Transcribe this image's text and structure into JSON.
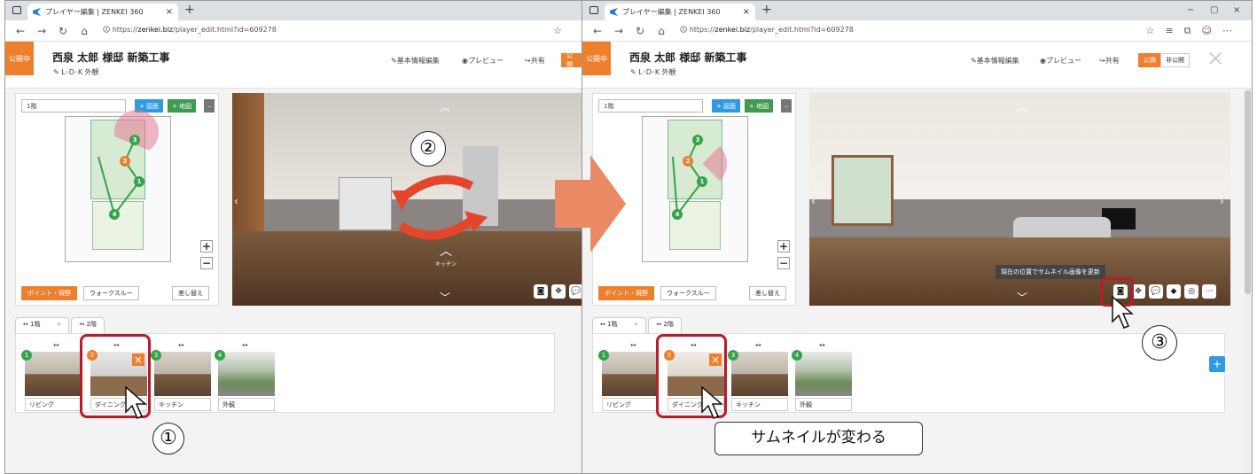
{
  "browser": {
    "tab_title": "プレイヤー編集 | ZENKEI 360",
    "url_host": "zenkei.biz",
    "url_prefix": "https://",
    "url_path": "/player_edit.html?id=609278"
  },
  "app": {
    "status": "公開中",
    "title": "西泉 太郎 様邸 新築工事",
    "tags": "L･D･K 外観",
    "menu": {
      "basic": "基本情報編集",
      "preview": "プレビュー",
      "share": "共有",
      "public": "公開",
      "private": "非公開"
    }
  },
  "plan": {
    "floor": "1階",
    "add_drawing": "+ 図面",
    "add_map": "+ 地図",
    "minus": "‒",
    "mode_point": "ポイント・視野",
    "mode_walk": "ウォークスルー",
    "replace": "差し替え",
    "zoom_in": "+",
    "zoom_out": "−",
    "points": [
      "1",
      "2",
      "3",
      "4"
    ]
  },
  "viewer": {
    "hotspot_label": "キッチン",
    "tooltip": "現在の位置でサムネイル画像を更新"
  },
  "floors": {
    "tab1": "1階",
    "tab2": "2階"
  },
  "thumbs": [
    {
      "num": "1",
      "label": "リビング",
      "color": "#37a24b"
    },
    {
      "num": "2",
      "label": "ダイニング",
      "color": "#ee7f2d"
    },
    {
      "num": "3",
      "label": "キッチン",
      "color": "#37a24b"
    },
    {
      "num": "4",
      "label": "外観",
      "color": "#37a24b"
    }
  ],
  "steps": {
    "one": "①",
    "two": "②",
    "three": "③"
  },
  "caption": "サムネイルが変わる",
  "add_point": "+"
}
